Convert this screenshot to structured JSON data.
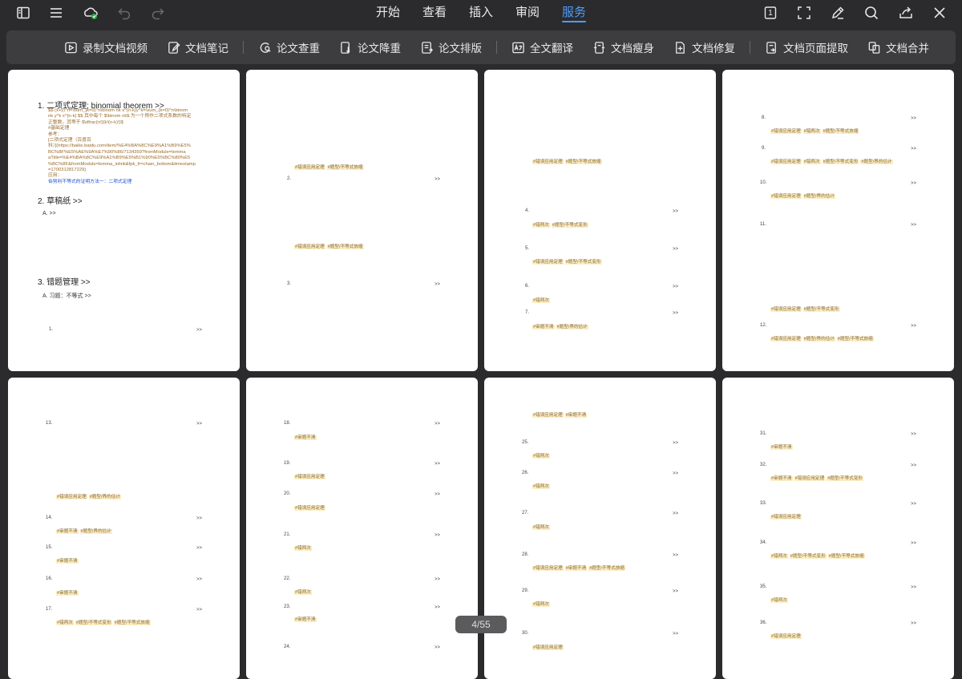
{
  "tabs": [
    "开始",
    "查看",
    "插入",
    "审阅",
    "服务"
  ],
  "active_tab": "服务",
  "top_icons": {
    "left": [
      "sidebar-icon",
      "menu-icon",
      "cloud-sync-icon",
      "undo-icon",
      "redo-icon"
    ],
    "right": [
      "page-number-icon",
      "fullscreen-icon",
      "pen-icon",
      "search-icon",
      "share-icon",
      "close-icon"
    ]
  },
  "page_number_badge": "1",
  "toolbar": {
    "items": [
      {
        "label": "录制文档视频",
        "icon": "record-video-icon"
      },
      {
        "label": "文档笔记",
        "icon": "note-icon"
      },
      {
        "label": "论文查重",
        "icon": "plagiarism-icon"
      },
      {
        "label": "论文降重",
        "icon": "reduce-icon"
      },
      {
        "label": "论文排版",
        "icon": "layout-icon"
      },
      {
        "label": "全文翻译",
        "icon": "translate-icon"
      },
      {
        "label": "文档瘦身",
        "icon": "slim-icon"
      },
      {
        "label": "文档修复",
        "icon": "repair-icon"
      },
      {
        "label": "文档页面提取",
        "icon": "extract-icon"
      },
      {
        "label": "文档合并",
        "icon": "merge-icon"
      }
    ]
  },
  "page1": {
    "h1": "1.  二项式定理; binomial theorem >>",
    "body": [
      "$$ (x+y)^n=\\sum_{k=0}^n\\binom nk x^{n-k}y^k=\\sum_{k=0}^n\\binom",
      "nk y^k x^{n-k} $$ 其中每个 $\\binom nk$ 为一个称作二项式系数的特定",
      "正整数，其等于 $\\dfrac{n!}{k!(n-k)!}$",
      "#基础定理",
      "参考：",
      "[二项式定理（百度百",
      "科）](https://baike.baidu.com/item/%E4%BA%8C%E9%A1%B9%E5%",
      "BC%8F%E5%AE%9A%E7%90%86/7134359?fromModule=lemma",
      "aTitle=%E4%BA%8C%E9%A1%B9%E5%B1%90%E5%BC%80%E5",
      "%BC%8F&fromModule=lemma_inlink&fpk_fr=chain_bottom&timestamp",
      "=1700312817229)",
      "应用："
    ],
    "link": "伯努利不等式的证明方法一：二项式定理",
    "h2": "2.  草稿纸  >>",
    "h2a": "A.    >>",
    "h3": "3.  错题管理  >>",
    "h3a": "A.  习题：不等式  >>",
    "item1": "1."
  },
  "arrow": ">>",
  "page2": {
    "tags_a": [
      "#错误应用定理",
      "#题型/不等式放缩"
    ],
    "n2": "2.",
    "tags_b": [
      "#错误应用定理",
      "#题型/不等式放缩"
    ],
    "n3": "3."
  },
  "page3": {
    "t1": [
      "#错误应用定理",
      "#题型/不等式放缩"
    ],
    "n4": "4.",
    "t4": [
      "#错两次",
      "#题型/不等式变形"
    ],
    "n5": "5.",
    "t5": [
      "#错误应用定理",
      "#题型/不等式变形"
    ],
    "n6": "6.",
    "t6": [
      "#错两次"
    ],
    "n7": "7.",
    "t7": [
      "#审题不清",
      "#题型/界的估计"
    ]
  },
  "page4": {
    "n8": "8.",
    "t8": [
      "#错误应用定理",
      "#错两次",
      "#题型/不等式放缩"
    ],
    "n9": "9.",
    "t9": [
      "#错误应用定理",
      "#错两次",
      "#题型/不等式变形",
      "#题型/界的估计"
    ],
    "n10": "10.",
    "t10": [
      "#错误应用定理",
      "#题型/界的估计"
    ],
    "n11": "11.",
    "t11b": [
      "#错误应用定理",
      "#题型/不等式变形"
    ],
    "n12": "12.",
    "t12": [
      "#错误应用定理",
      "#题型/界的估计",
      "#题型/不等式放缩"
    ]
  },
  "page5": {
    "n13": "13.",
    "t13": [
      "#错误应用定理",
      "#题型/界的估计"
    ],
    "n14": "14.",
    "t14": [
      "#审题不清",
      "#题型/界的估计"
    ],
    "n15": "15.",
    "t15": [
      "#审题不清"
    ],
    "n16": "16.",
    "t16": [
      "#审题不清"
    ],
    "n17": "17.",
    "t17": [
      "#错两次",
      "#题型/不等式变形",
      "#题型/不等式放缩"
    ]
  },
  "page6": {
    "n18": "18.",
    "t18": [
      "#审题不清"
    ],
    "n19": "19.",
    "t19": [
      "#错误应用定理"
    ],
    "n20": "20.",
    "t20": [
      "#错误应用定理"
    ],
    "n21": "21.",
    "t21": [
      "#错两次"
    ],
    "n22": "22.",
    "t22": [
      "#错两次"
    ],
    "n23": "23.",
    "t23": [
      "#审题不清"
    ],
    "n24": "24."
  },
  "page7": {
    "t0": [
      "#错误应用定理",
      "#审题不清"
    ],
    "n25": "25.",
    "t25": [
      "#错两次"
    ],
    "n26": "26.",
    "t26": [
      "#错两次"
    ],
    "n27": "27.",
    "t27": [
      "#错两次"
    ],
    "n28": "28.",
    "t28": [
      "#错误应用定理",
      "#审题不清",
      "#题型/不等式放缩"
    ],
    "n29": "29.",
    "t29": [
      "#错两次"
    ],
    "n30": "30.",
    "t30": [
      "#错误应用定理"
    ]
  },
  "page8": {
    "n31": "31.",
    "t31": [
      "#审题不清"
    ],
    "n32": "32.",
    "t32": [
      "#审题不清",
      "#错误应用定理",
      "#题型/不等式变形"
    ],
    "n33": "33.",
    "t33": [
      "#错误应用定理"
    ],
    "n34": "34.",
    "t34": [
      "#错两次",
      "#题型/不等式变形",
      "#题型/不等式放缩"
    ],
    "n35": "35.",
    "t35": [
      "#错两次"
    ],
    "n36": "36.",
    "t36": [
      "#错误应用定理"
    ]
  },
  "indicator": "4/55"
}
